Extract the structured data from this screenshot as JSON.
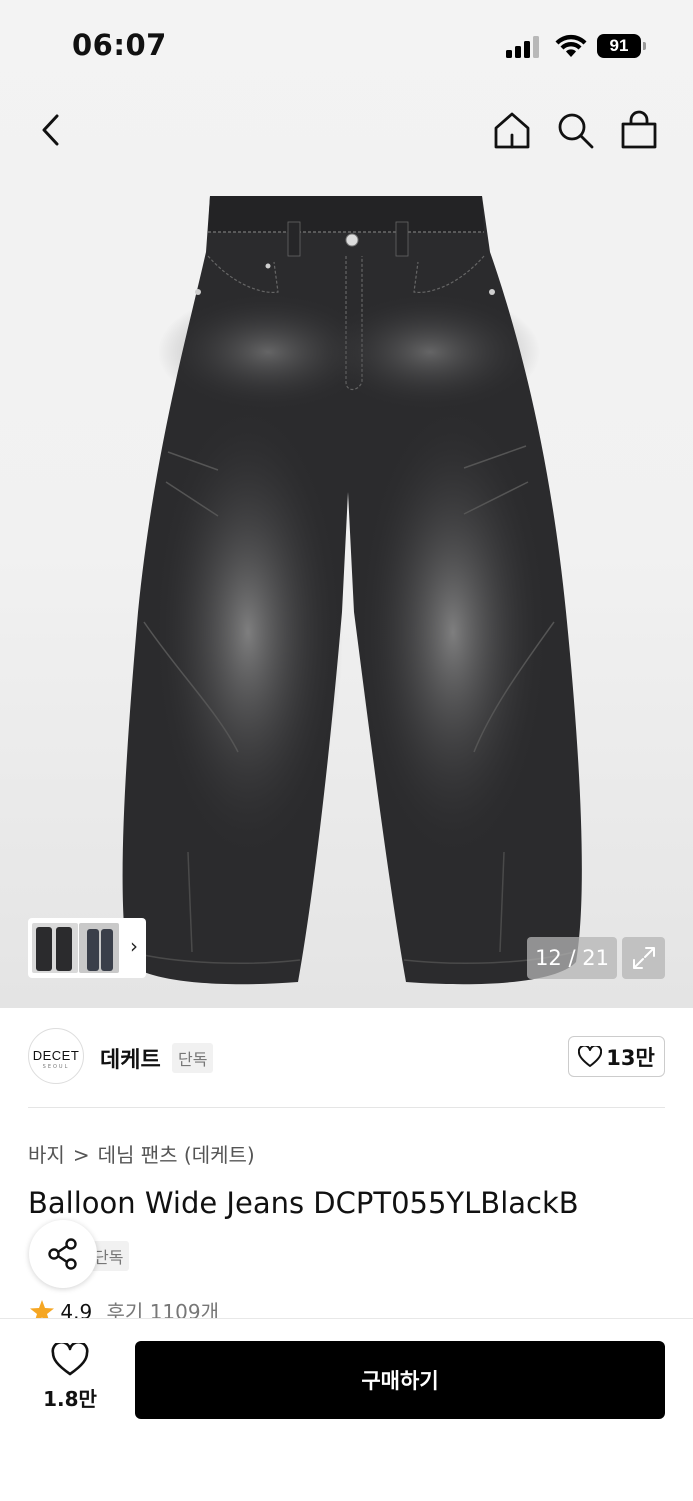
{
  "status_bar": {
    "time": "06:07",
    "battery": "91"
  },
  "nav": {
    "back_icon": "chevron-left-icon",
    "home_icon": "home-icon",
    "search_icon": "search-icon",
    "bag_icon": "shopping-bag-icon"
  },
  "gallery": {
    "counter": "12 / 21",
    "image_subject": "black washed balloon wide jeans",
    "expand_icon": "expand-icon",
    "thumbnail_arrow": "›"
  },
  "brand": {
    "logo_text": "DECET",
    "logo_subtext": "SEOUL",
    "name": "데케트",
    "badge": "단독",
    "likes": "13만"
  },
  "breadcrumb": {
    "category": "바지",
    "separator": ">",
    "subcategory": "데님 팬츠 (데케트)"
  },
  "product": {
    "title": "Balloon Wide Jeans DCPT055YLBlackB",
    "badge": "단독",
    "rating": "4.9",
    "reviews": "후기 1109개"
  },
  "bottom_bar": {
    "wish_count": "1.8만",
    "buy_label": "구매하기"
  },
  "colors": {
    "accent": "#000000",
    "star": "#f5a623",
    "denim": "#2b2b2d"
  }
}
